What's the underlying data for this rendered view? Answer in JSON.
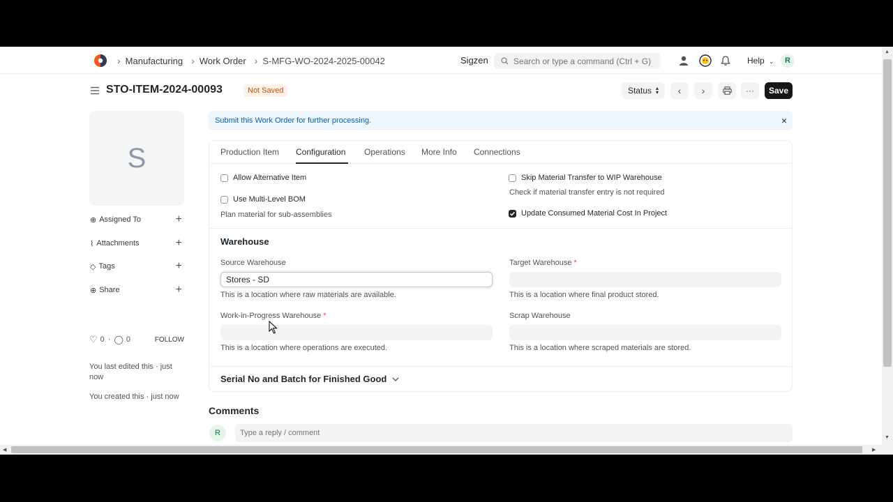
{
  "navbar": {
    "breadcrumbs": [
      "Manufacturing",
      "Work Order",
      "S-MFG-WO-2024-2025-00042"
    ],
    "site_name": "Sigzen",
    "search_placeholder": "Search or type a command (Ctrl + G)",
    "help_label": "Help",
    "user_initial": "R"
  },
  "page": {
    "title": "STO-ITEM-2024-00093",
    "status_indicator": "Not Saved",
    "status_button": "Status",
    "save_label": "Save"
  },
  "sidebar": {
    "image_initial": "S",
    "items": [
      {
        "label": "Assigned To",
        "icon": "assign-icon"
      },
      {
        "label": "Attachments",
        "icon": "paperclip-icon"
      },
      {
        "label": "Tags",
        "icon": "tag-icon"
      },
      {
        "label": "Share",
        "icon": "share-icon"
      }
    ],
    "likes": "0",
    "comments": "0",
    "follow_label": "FOLLOW",
    "last_edited": "You last edited this · just now",
    "created": "You created this · just now"
  },
  "alert": {
    "message": "Submit this Work Order for further processing."
  },
  "tabs": [
    "Production Item",
    "Configuration",
    "Operations",
    "More Info",
    "Connections"
  ],
  "active_tab": "Configuration",
  "config": {
    "allow_alternative": {
      "label": "Allow Alternative Item",
      "checked": false
    },
    "multi_level_bom": {
      "label": "Use Multi-Level BOM",
      "checked": false,
      "help": "Plan material for sub-assemblies"
    },
    "skip_transfer": {
      "label": "Skip Material Transfer to WIP Warehouse",
      "checked": false,
      "help": "Check if material transfer entry is not required"
    },
    "update_cost": {
      "label": "Update Consumed Material Cost In Project",
      "checked": true
    }
  },
  "warehouse": {
    "section_title": "Warehouse",
    "source": {
      "label": "Source Warehouse",
      "value": "Stores - SD",
      "help": "This is a location where raw materials are available."
    },
    "target": {
      "label": "Target Warehouse",
      "required_mark": "*",
      "value": "",
      "help": "This is a location where final product stored."
    },
    "wip": {
      "label": "Work-in-Progress Warehouse",
      "required_mark": "*",
      "value": "",
      "help": "This is a location where operations are executed."
    },
    "scrap": {
      "label": "Scrap Warehouse",
      "value": "",
      "help": "This is a location where scraped materials are stored."
    }
  },
  "serial_section": "Serial No and Batch for Finished Good",
  "comments": {
    "title": "Comments",
    "avatar_initial": "R",
    "placeholder": "Type a reply / comment"
  }
}
